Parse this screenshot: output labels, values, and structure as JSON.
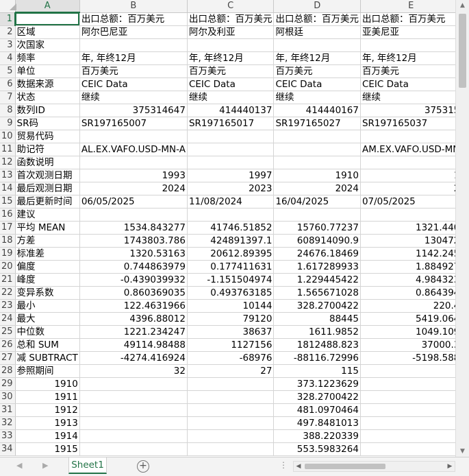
{
  "spreadsheet": {
    "columns": [
      "A",
      "B",
      "C",
      "D",
      "E"
    ],
    "selected_cell": "A1",
    "row_numbers": [
      1,
      2,
      3,
      4,
      5,
      6,
      7,
      8,
      9,
      10,
      11,
      12,
      13,
      14,
      15,
      16,
      17,
      18,
      19,
      20,
      21,
      22,
      23,
      24,
      25,
      26,
      27,
      28,
      29,
      30,
      31,
      32,
      33,
      34
    ],
    "rows": [
      [
        "",
        "出口总额：百万美元",
        "出口总额：百万美元",
        "出口总额：百万美元",
        "出口总额：百万美元"
      ],
      [
        "区域",
        "阿尔巴尼亚",
        "阿尔及利亚",
        "阿根廷",
        "亚美尼亚"
      ],
      [
        "次国家",
        "",
        "",
        "",
        ""
      ],
      [
        "频率",
        "年, 年终12月",
        "年, 年终12月",
        "年, 年终12月",
        "年, 年终12月"
      ],
      [
        "单位",
        "百万美元",
        "百万美元",
        "百万美元",
        "百万美元"
      ],
      [
        "数据来源",
        "CEIC Data",
        "CEIC Data",
        "CEIC Data",
        "CEIC Data"
      ],
      [
        "状态",
        "继续",
        "继续",
        "继续",
        "继续"
      ],
      [
        "数列ID",
        "375314647",
        "414440137",
        "414440167",
        "375315"
      ],
      [
        "SR码",
        "SR197165007",
        "SR197165017",
        "SR197165027",
        "SR197165037"
      ],
      [
        "贸易代码",
        "",
        "",
        "",
        ""
      ],
      [
        "助记符",
        "AL.EX.VAFO.USD-MN-A",
        "",
        "",
        "AM.EX.VAFO.USD-MN"
      ],
      [
        "函数说明",
        "",
        "",
        "",
        ""
      ],
      [
        "首次观测日期",
        "1993",
        "1997",
        "1910",
        "1"
      ],
      [
        "最后观测日期",
        "2024",
        "2023",
        "2024",
        "2"
      ],
      [
        "最后更新时间",
        "06/05/2025",
        "11/08/2024",
        "16/04/2025",
        "07/05/2025"
      ],
      [
        "建议",
        "",
        "",
        "",
        ""
      ],
      [
        "平均 MEAN",
        "1534.843277",
        "41746.51852",
        "15760.77237",
        "1321.440"
      ],
      [
        "方差",
        "1743803.786",
        "424891397.1",
        "608914090.9",
        "130472"
      ],
      [
        "标准差",
        "1320.53163",
        "20612.89395",
        "24676.18469",
        "1142.245"
      ],
      [
        "偏度",
        "0.744863979",
        "0.177411631",
        "1.617289933",
        "1.884927"
      ],
      [
        "峰度",
        "-0.439039932",
        "-1.151504974",
        "1.229445422",
        "4.984323"
      ],
      [
        "变异系数",
        "0.860369035",
        "0.493763185",
        "1.565671028",
        "0.864394"
      ],
      [
        "最小",
        "122.4631966",
        "10144",
        "328.2700422",
        "220.4"
      ],
      [
        "最大",
        "4396.88012",
        "79120",
        "88445",
        "5419.064"
      ],
      [
        "中位数",
        "1221.234247",
        "38637",
        "1611.9852",
        "1049.109"
      ],
      [
        "总和 SUM",
        "49114.98488",
        "1127156",
        "1812488.823",
        "37000.3"
      ],
      [
        "减 SUBTRACT",
        "-4274.416924",
        "-68976",
        "-88116.72996",
        "-5198.588"
      ],
      [
        "参照期间",
        "32",
        "27",
        "115",
        ""
      ],
      [
        "1910",
        "",
        "",
        "373.1223629",
        ""
      ],
      [
        "1911",
        "",
        "",
        "328.2700422",
        ""
      ],
      [
        "1912",
        "",
        "",
        "481.0970464",
        ""
      ],
      [
        "1913",
        "",
        "",
        "497.8481013",
        ""
      ],
      [
        "1914",
        "",
        "",
        "388.220339",
        ""
      ],
      [
        "1915",
        "",
        "",
        "553.5983264",
        ""
      ]
    ],
    "numeric_rows": [
      8,
      13,
      14,
      17,
      18,
      19,
      20,
      21,
      22,
      23,
      24,
      25,
      26,
      27,
      28,
      29,
      30,
      31,
      32,
      33,
      34
    ]
  },
  "sheet_tabs": [
    "Sheet1"
  ],
  "icons": {
    "add_sheet": "plus-circle-icon",
    "nav_prev": "triangle-left-icon",
    "nav_next": "triangle-right-icon",
    "scroll_up": "triangle-up-icon",
    "scroll_down": "triangle-down-icon"
  },
  "colors": {
    "accent": "#217346",
    "header_bg": "#f3f3f3",
    "grid_line": "#d4d4d4"
  }
}
